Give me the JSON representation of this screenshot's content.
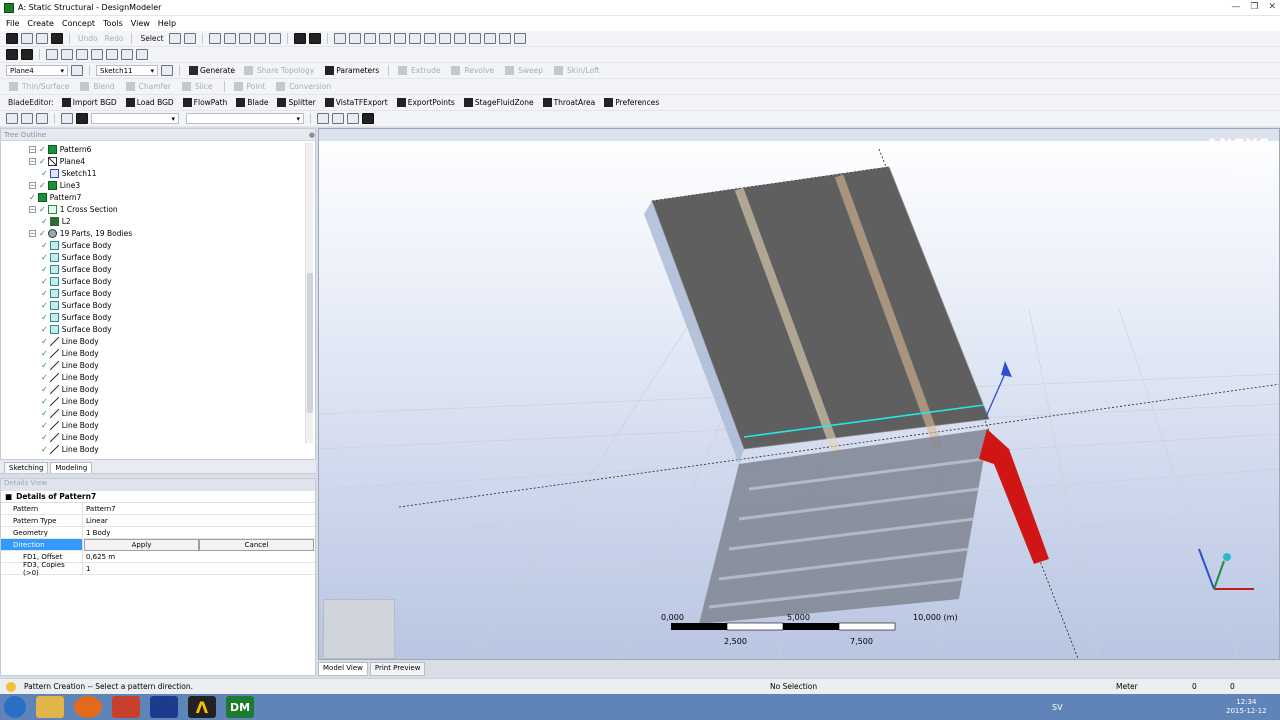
{
  "window": {
    "title": "A: Static Structural - DesignModeler"
  },
  "menu": [
    "File",
    "Create",
    "Concept",
    "Tools",
    "View",
    "Help"
  ],
  "toolbar1": {
    "undo": "Undo",
    "redo": "Redo",
    "select": "Select"
  },
  "toolbar3": {
    "plane": "Plane4",
    "sketch": "Sketch11",
    "generate": "Generate",
    "share_topology": "Share Topology",
    "parameters": "Parameters",
    "extrude": "Extrude",
    "revolve": "Revolve",
    "sweep": "Sweep",
    "skin_loft": "Skin/Loft"
  },
  "toolbar4": {
    "thin_surface": "Thin/Surface",
    "blend": "Blend",
    "chamfer": "Chamfer",
    "slice": "Slice",
    "point": "Point",
    "conversion": "Conversion"
  },
  "toolbar5": {
    "items": [
      "BladeEditor:",
      "Import BGD",
      "Load BGD",
      "FlowPath",
      "Blade",
      "Splitter",
      "VistaTFExport",
      "ExportPoints",
      "StageFluidZone",
      "ThroatArea",
      "Preferences"
    ]
  },
  "tree": {
    "header": "Tree Outline",
    "nodes": [
      {
        "label": "Pattern6",
        "icon": "pattern-icon",
        "indent": 2
      },
      {
        "label": "Plane4",
        "icon": "plane-icon",
        "indent": 2
      },
      {
        "label": "Sketch11",
        "icon": "sketch-icon",
        "indent": 3
      },
      {
        "label": "Line3",
        "icon": "line-feature-icon",
        "indent": 2
      },
      {
        "label": "Pattern7",
        "icon": "pattern-icon",
        "indent": 2
      },
      {
        "label": "1 Cross Section",
        "icon": "cross-section-icon",
        "indent": 2
      },
      {
        "label": "L2",
        "icon": "cross-section-item-icon",
        "indent": 3
      },
      {
        "label": "19 Parts, 19 Bodies",
        "icon": "parts-icon",
        "indent": 2
      },
      {
        "label": "Surface Body",
        "icon": "surface-body-icon",
        "indent": 3
      },
      {
        "label": "Surface Body",
        "icon": "surface-body-icon",
        "indent": 3
      },
      {
        "label": "Surface Body",
        "icon": "surface-body-icon",
        "indent": 3
      },
      {
        "label": "Surface Body",
        "icon": "surface-body-icon",
        "indent": 3
      },
      {
        "label": "Surface Body",
        "icon": "surface-body-icon",
        "indent": 3
      },
      {
        "label": "Surface Body",
        "icon": "surface-body-icon",
        "indent": 3
      },
      {
        "label": "Surface Body",
        "icon": "surface-body-icon",
        "indent": 3
      },
      {
        "label": "Surface Body",
        "icon": "surface-body-icon",
        "indent": 3
      },
      {
        "label": "Line Body",
        "icon": "line-body-icon",
        "indent": 3
      },
      {
        "label": "Line Body",
        "icon": "line-body-icon",
        "indent": 3
      },
      {
        "label": "Line Body",
        "icon": "line-body-icon",
        "indent": 3
      },
      {
        "label": "Line Body",
        "icon": "line-body-icon",
        "indent": 3
      },
      {
        "label": "Line Body",
        "icon": "line-body-icon",
        "indent": 3
      },
      {
        "label": "Line Body",
        "icon": "line-body-icon",
        "indent": 3
      },
      {
        "label": "Line Body",
        "icon": "line-body-icon",
        "indent": 3
      },
      {
        "label": "Line Body",
        "icon": "line-body-icon",
        "indent": 3
      },
      {
        "label": "Line Body",
        "icon": "line-body-icon",
        "indent": 3
      },
      {
        "label": "Line Body",
        "icon": "line-body-icon",
        "indent": 3
      }
    ]
  },
  "tabs": {
    "sketching": "Sketching",
    "modeling": "Modeling"
  },
  "details": {
    "header": "Details View",
    "title": "Details of Pattern7",
    "rows": [
      {
        "k": "Pattern",
        "v": "Pattern7"
      },
      {
        "k": "Pattern Type",
        "v": "Linear"
      },
      {
        "k": "Geometry",
        "v": "1 Body"
      }
    ],
    "direction_key": "Direction",
    "apply": "Apply",
    "cancel": "Cancel",
    "offset_key": "FD1, Offset",
    "offset_val": "0,625 m",
    "copies_key": "FD3, Copies (>0)",
    "copies_val": "1"
  },
  "viewport": {
    "logo_main": "ANSYS",
    "logo_ver": "R14.5",
    "logo_sub": "Academic",
    "scale_labels": [
      "0,000",
      "5,000",
      "10,000 (m)",
      "2,500",
      "7,500"
    ]
  },
  "view_tabs": {
    "model": "Model View",
    "print": "Print Preview"
  },
  "status": {
    "message": "Pattern Creation -- Select a pattern direction.",
    "selection": "No Selection",
    "unit": "Meter",
    "v1": "0",
    "v2": "0"
  },
  "clock": {
    "time": "12:34",
    "date": "2015-12-12"
  },
  "lang": "SV"
}
